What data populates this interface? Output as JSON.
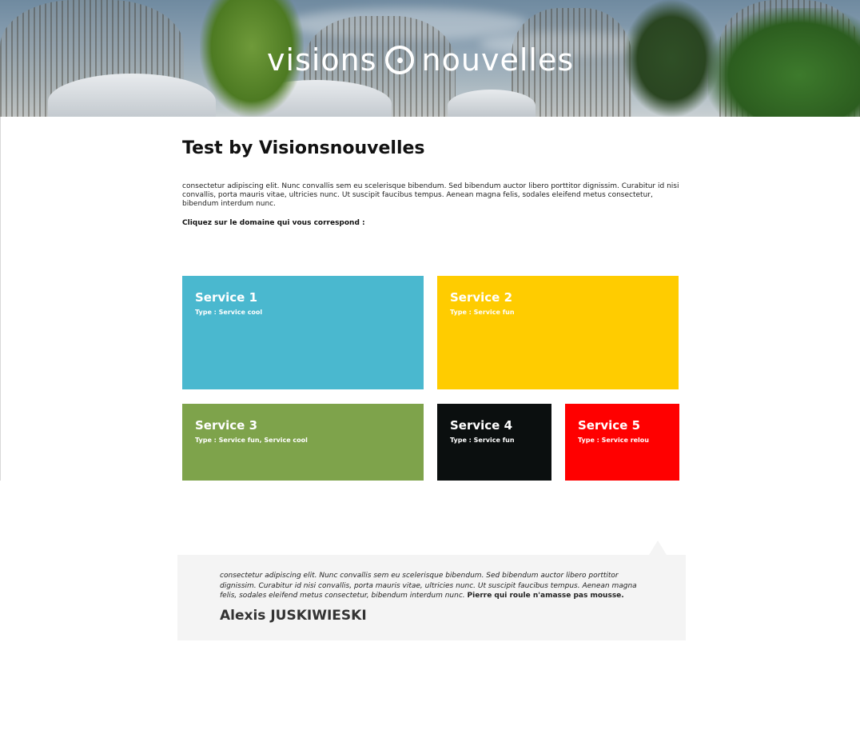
{
  "header": {
    "brand_left": "visions",
    "brand_right": "nouvelles"
  },
  "page": {
    "title": "Test by Visionsnouvelles",
    "intro": "consectetur adipiscing elit. Nunc convallis sem eu scelerisque bibendum. Sed bibendum auctor libero porttitor dignissim. Curabitur id nisi convallis, porta mauris vitae, ultricies nunc. Ut suscipit faucibus tempus. Aenean magna felis, sodales eleifend metus consectetur, bibendum interdum nunc.",
    "cta": "Cliquez sur le domaine qui vous correspond :"
  },
  "services": [
    {
      "title": "Service 1",
      "type": "Type : Service cool",
      "color": "#4ab8cf"
    },
    {
      "title": "Service 2",
      "type": "Type : Service fun",
      "color": "#ffcc00"
    },
    {
      "title": "Service 3",
      "type": "Type : Service fun, Service cool",
      "color": "#7ea34b"
    },
    {
      "title": "Service 4",
      "type": "Type : Service fun",
      "color": "#0b0f0f"
    },
    {
      "title": "Service 5",
      "type": "Type : Service relou",
      "color": "#ff0000"
    }
  ],
  "testimonial": {
    "quote": "consectetur adipiscing elit. Nunc convallis sem eu scelerisque bibendum. Sed bibendum auctor libero porttitor dignissim. Curabitur id nisi convallis, porta mauris vitae, ultricies nunc. Ut suscipit faucibus tempus. Aenean magna felis, sodales eleifend metus consectetur, bibendum interdum nunc.",
    "quote_bold": "Pierre qui roule n'amasse pas mousse.",
    "author": "Alexis JUSKIWIESKI"
  }
}
